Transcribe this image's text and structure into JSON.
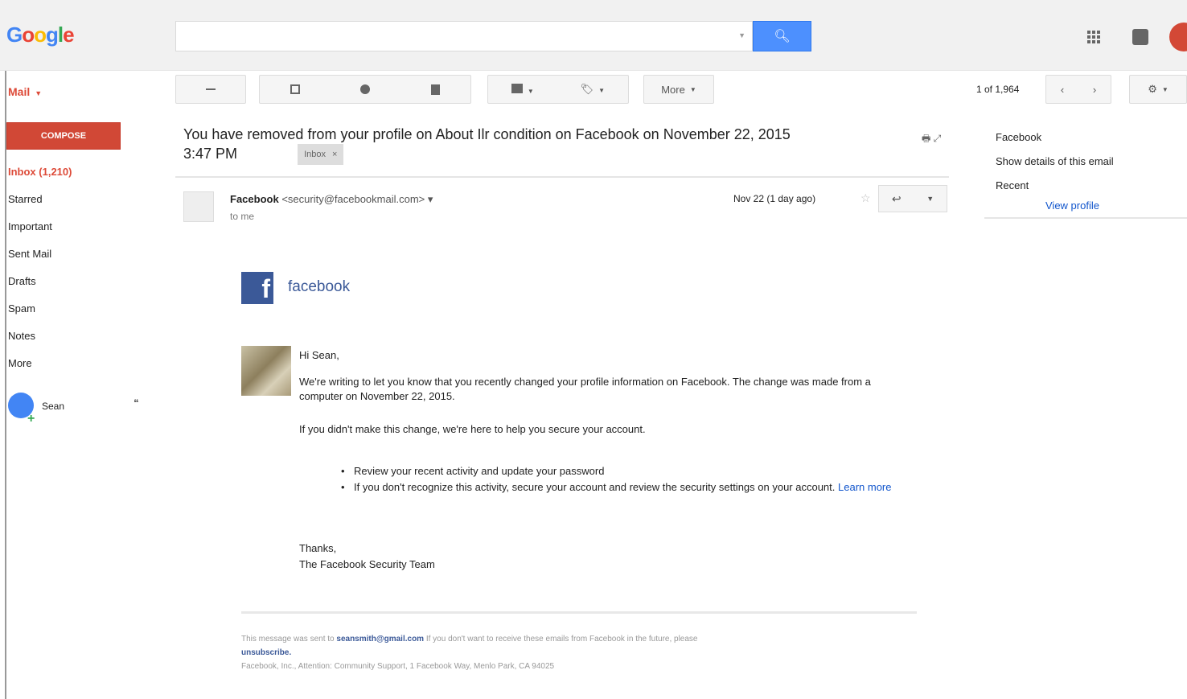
{
  "header": {
    "logo": [
      "G",
      "o",
      "o",
      "g",
      "l",
      "e"
    ],
    "search_value": "",
    "search_placeholder": ""
  },
  "toolbar": {
    "mail_label": "Mail",
    "more_label": "More",
    "pager": "1 of 1,964"
  },
  "sidebar": {
    "compose_label": "COMPOSE",
    "items": [
      {
        "label": "Inbox (1,210)"
      },
      {
        "label": "Starred"
      },
      {
        "label": "Important"
      },
      {
        "label": "Sent Mail"
      },
      {
        "label": "Drafts"
      },
      {
        "label": "Spam"
      },
      {
        "label": "Notes"
      },
      {
        "label": "More"
      }
    ],
    "hangout_name": "Sean"
  },
  "message": {
    "subject": "You have removed from your profile on About Ilr condition on Facebook on November 22, 2015",
    "subject_time": "3:47 PM",
    "label_chip": "Inbox",
    "sender_name": "Facebook",
    "sender_addr": "<security@facebookmail.com>",
    "to_line": "to me",
    "date": "Nov 22 (1 day ago)"
  },
  "right_panel": {
    "line1": "Facebook",
    "line2": "Show details of this email",
    "line3": "Recent",
    "link": "View profile"
  },
  "body": {
    "brand": "facebook",
    "greeting": "Hi Sean,",
    "para1": "We're writing to let you know that you recently changed your profile information on Facebook. The change was made from a computer on November 22, 2015.",
    "para2": "If you didn't make this change, we're here to help you secure your account.",
    "bullet1": "Review your recent activity and update your password",
    "bullet2_pre": "If you don't recognize this activity, secure your account and review the security settings on your account.",
    "bullet2_link": "Learn more",
    "signoff1": "Thanks,",
    "signoff2": "The Facebook Security Team",
    "footer1_pre": "This message was sent to",
    "footer1_link": "seansmith@gmail.com",
    "footer1_post": "If you don't want to receive these emails from Facebook in the future, please",
    "footer2": "unsubscribe.",
    "footer3": "Facebook, Inc., Attention: Community Support, 1 Facebook Way, Menlo Park, CA 94025"
  }
}
